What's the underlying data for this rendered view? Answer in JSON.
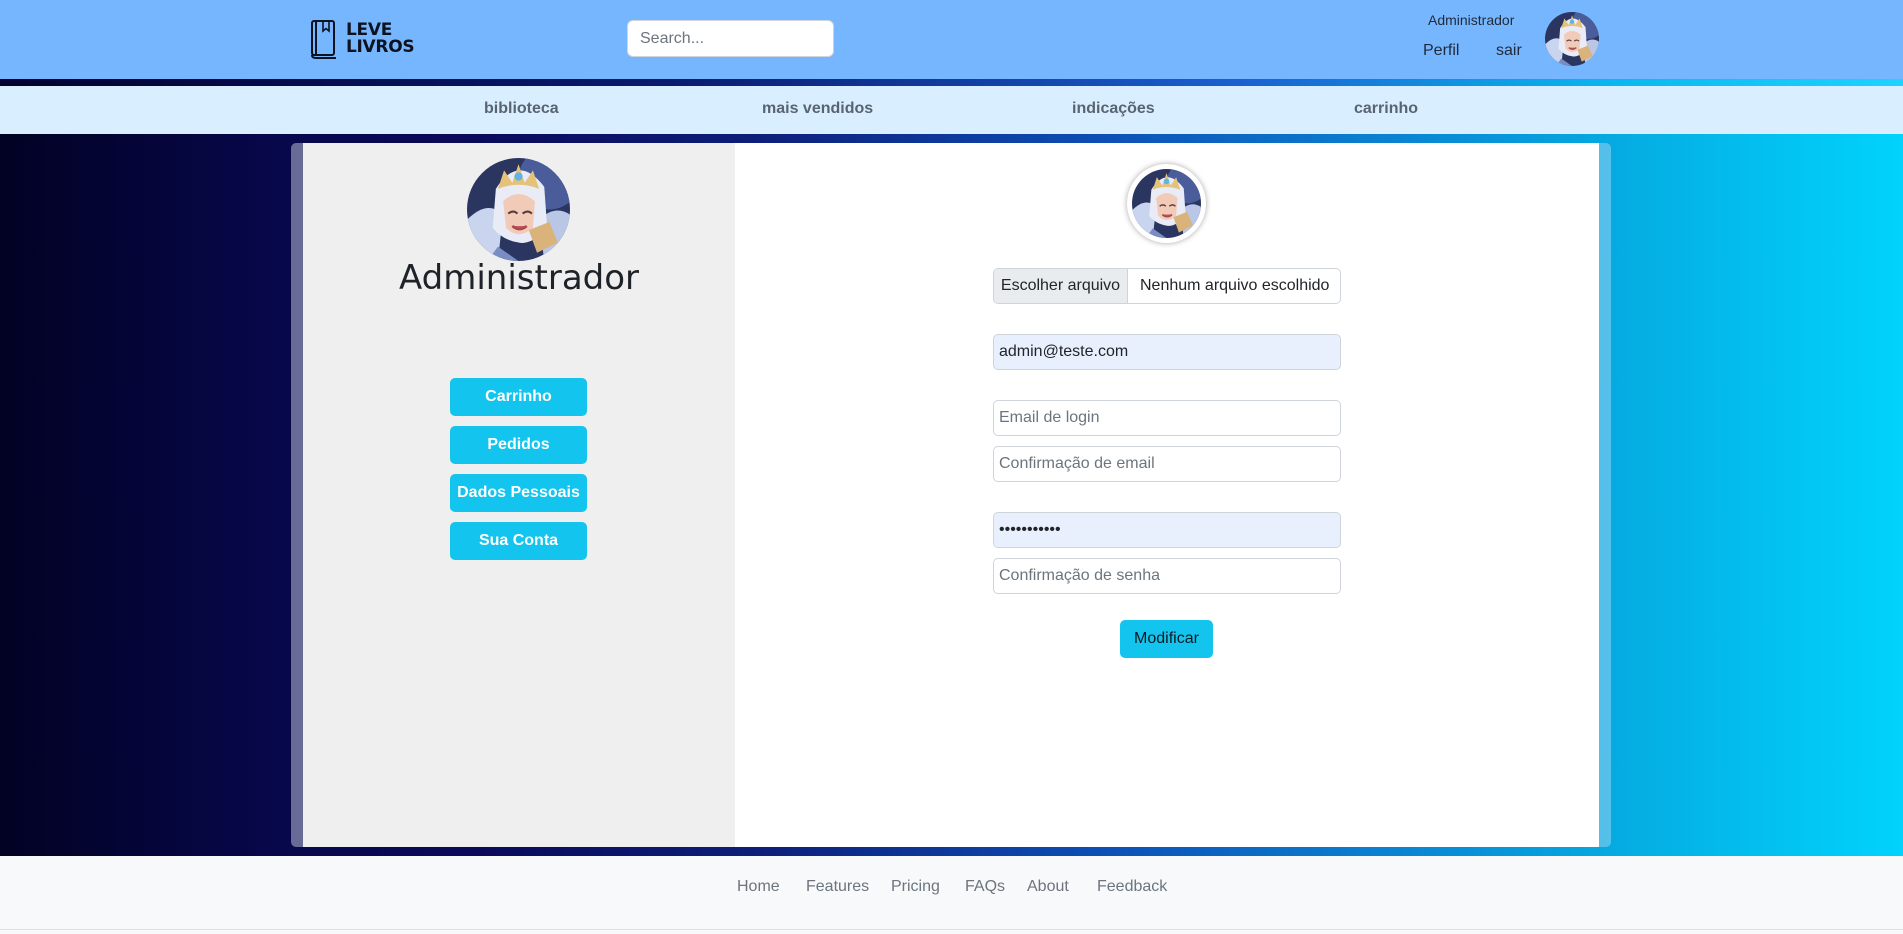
{
  "header": {
    "logo_line1": "LEVE",
    "logo_line2": "LIVROS",
    "search_placeholder": "Search...",
    "user_name": "Administrador",
    "profile_link": "Perfil",
    "logout_link": "sair"
  },
  "subnav": {
    "items": [
      "biblioteca",
      "mais vendidos",
      "indicações",
      "carrinho"
    ]
  },
  "sidebar": {
    "title": "Administrador",
    "buttons": [
      "Carrinho",
      "Pedidos",
      "Dados Pessoais",
      "Sua Conta"
    ]
  },
  "form": {
    "file_button": "Escolher arquivo",
    "file_status": "Nenhum arquivo escolhido",
    "email_value": "admin@teste.com",
    "email_login_placeholder": "Email de login",
    "email_confirm_placeholder": "Confirmação de email",
    "password_value": "•••••••••••",
    "password_confirm_placeholder": "Confirmação de senha",
    "submit_label": "Modificar"
  },
  "footer": {
    "links": [
      "Home",
      "Features",
      "Pricing",
      "FAQs",
      "About",
      "Feedback"
    ]
  },
  "colors": {
    "header_bg": "#76b6ff",
    "subnav_bg": "#d9efff",
    "accent_button": "#13c5ee",
    "sidebar_bg": "#efefef",
    "footer_bg": "#f8f9fa"
  },
  "icons": {
    "logo": "book-icon",
    "avatar": "user-avatar"
  }
}
